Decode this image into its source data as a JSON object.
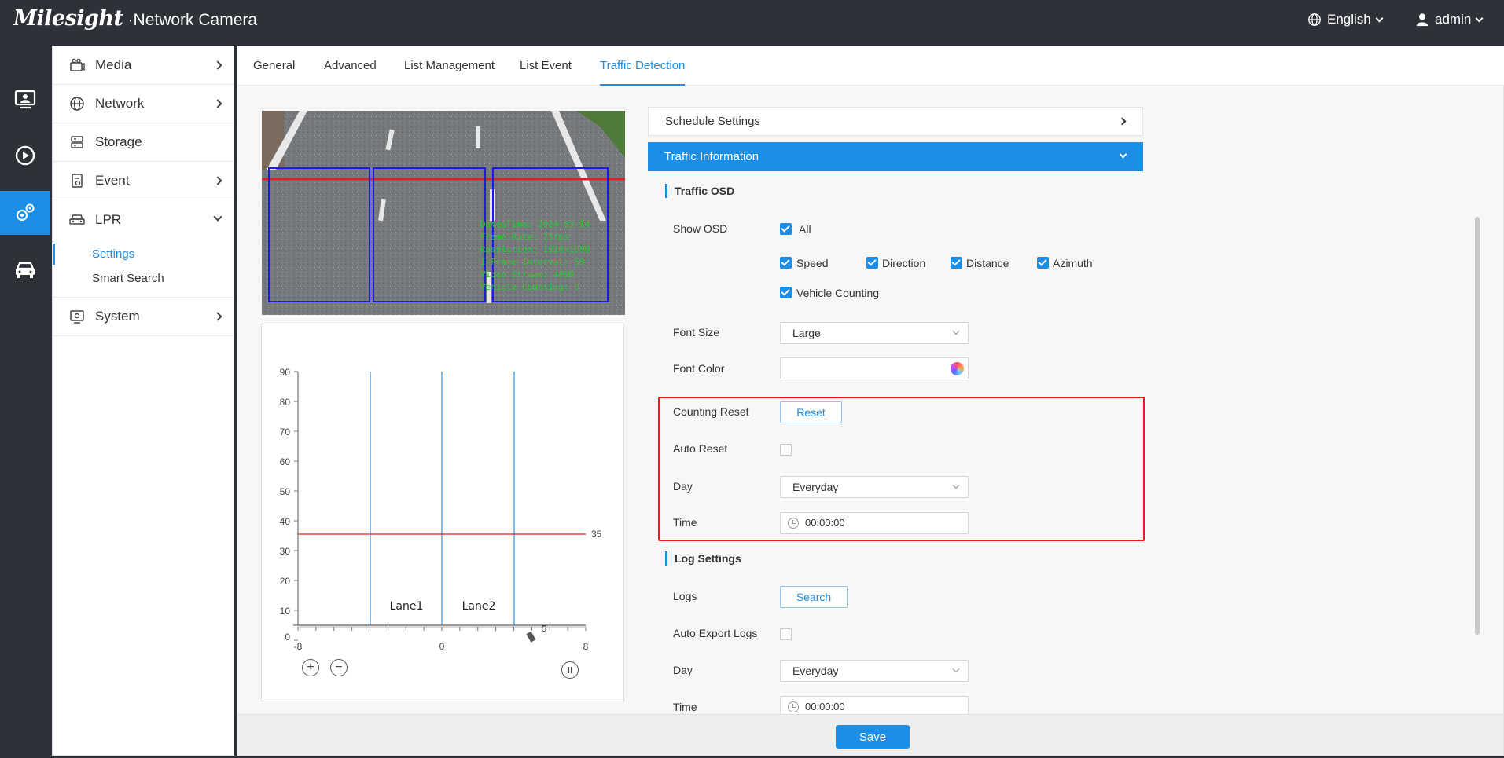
{
  "header": {
    "brand_logo": "Milesight",
    "brand_sub": "Network Camera",
    "language": "English",
    "user": "admin"
  },
  "rail": {
    "items": [
      {
        "icon": "live-view-icon"
      },
      {
        "icon": "playback-icon"
      },
      {
        "icon": "settings-icon"
      },
      {
        "icon": "vehicle-icon"
      }
    ],
    "active_index": 2
  },
  "sidebar": {
    "media": "Media",
    "network": "Network",
    "storage": "Storage",
    "event": "Event",
    "lpr": "LPR",
    "lpr_sub": [
      "Settings",
      "Smart Search"
    ],
    "system": "System"
  },
  "tabs": [
    "General",
    "Advanced",
    "List Management",
    "List Event",
    "Traffic Detection"
  ],
  "active_tab": "Traffic Detection",
  "video_osd": [
    "Date&Time: 2024-03-14",
    "Frame Rate: 25fps",
    "Resolution: 1920x1080",
    "I-Frame Interval: 50",
    "Video Stream: 4096",
    "Vehicle Counting: 0"
  ],
  "plot": {
    "y_ticks": [
      "90",
      "80",
      "70",
      "60",
      "50",
      "40",
      "30",
      "20",
      "10",
      "0"
    ],
    "x_ticks": [
      "-8",
      "0",
      "8"
    ],
    "lane_labels": [
      "Lane1",
      "Lane2"
    ],
    "detection_line_value": "35",
    "marker_value": "5"
  },
  "panels": {
    "schedule": "Schedule Settings",
    "traffic_info": "Traffic Information"
  },
  "traffic_osd": {
    "title": "Traffic OSD",
    "show_osd_label": "Show OSD",
    "options": [
      {
        "label": "All",
        "checked": true
      },
      {
        "label": "Speed",
        "checked": true
      },
      {
        "label": "Direction",
        "checked": true
      },
      {
        "label": "Distance",
        "checked": true
      },
      {
        "label": "Azimuth",
        "checked": true
      },
      {
        "label": "Vehicle Counting",
        "checked": true
      }
    ],
    "font_size_label": "Font Size",
    "font_size_value": "Large",
    "font_color_label": "Font Color"
  },
  "counting": {
    "reset_label": "Counting Reset",
    "reset_button": "Reset",
    "auto_reset_label": "Auto Reset",
    "auto_reset_checked": false,
    "day_label": "Day",
    "day_value": "Everyday",
    "time_label": "Time",
    "time_value": "00:00:00"
  },
  "log": {
    "title": "Log Settings",
    "logs_label": "Logs",
    "search_button": "Search",
    "auto_export_label": "Auto Export Logs",
    "auto_export_checked": false,
    "day_label": "Day",
    "day_value": "Everyday",
    "time_label": "Time",
    "time_value": "00:00:00"
  },
  "footer": {
    "save": "Save"
  },
  "colors": {
    "accent": "#1c8ee6",
    "topbar": "#2e3238",
    "highlight": "#f01818",
    "detection_box": "#1a1aee",
    "osd_text": "#22cc33"
  }
}
